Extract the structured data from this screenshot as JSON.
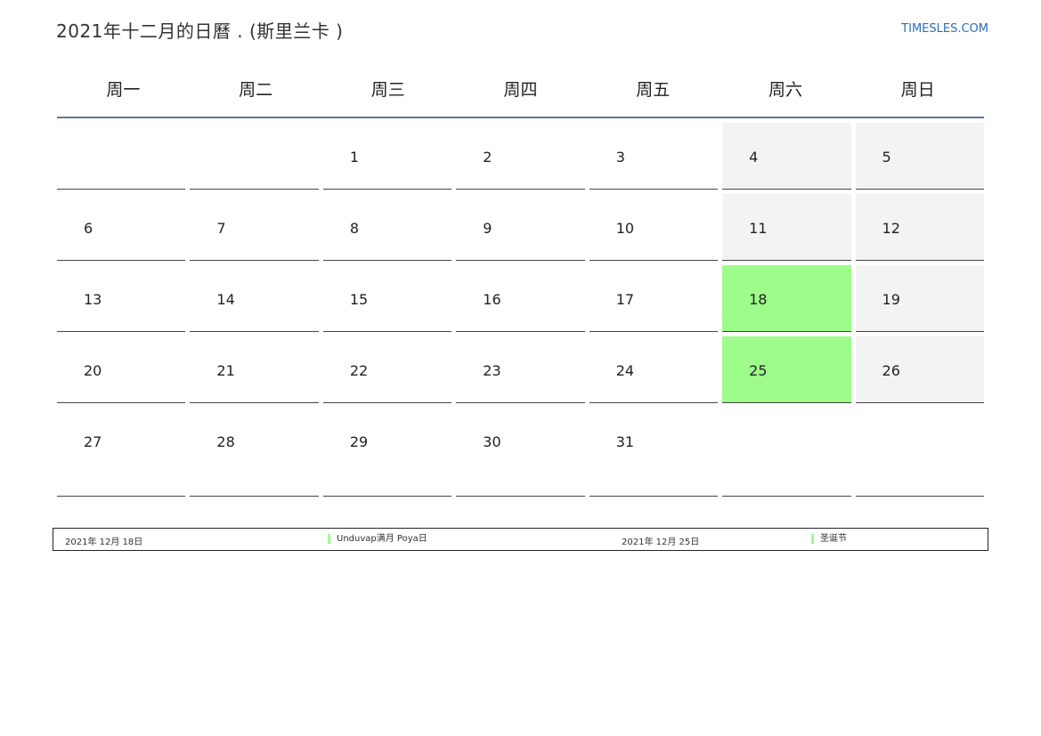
{
  "header": {
    "title": "2021年十二月的日曆 . (斯里兰卡 )",
    "site": "TIMESLES.COM"
  },
  "weekdays": [
    "周一",
    "周二",
    "周三",
    "周四",
    "周五",
    "周六",
    "周日"
  ],
  "weeks": [
    [
      "",
      "",
      "1",
      "2",
      "3",
      "4",
      "5"
    ],
    [
      "6",
      "7",
      "8",
      "9",
      "10",
      "11",
      "12"
    ],
    [
      "13",
      "14",
      "15",
      "16",
      "17",
      "18",
      "19"
    ],
    [
      "20",
      "21",
      "22",
      "23",
      "24",
      "25",
      "26"
    ],
    [
      "27",
      "28",
      "29",
      "30",
      "31",
      "",
      ""
    ]
  ],
  "holidays": [
    {
      "date": "2021年 12月 18日",
      "name": "Unduvap满月 Poya日"
    },
    {
      "date": "2021年 12月 25日",
      "name": "圣诞节"
    }
  ],
  "colors": {
    "holiday": "#9dfc8a",
    "weekend": "#f3f3f3",
    "header_rule": "#5c7a9a",
    "link": "#2a6fb5"
  }
}
